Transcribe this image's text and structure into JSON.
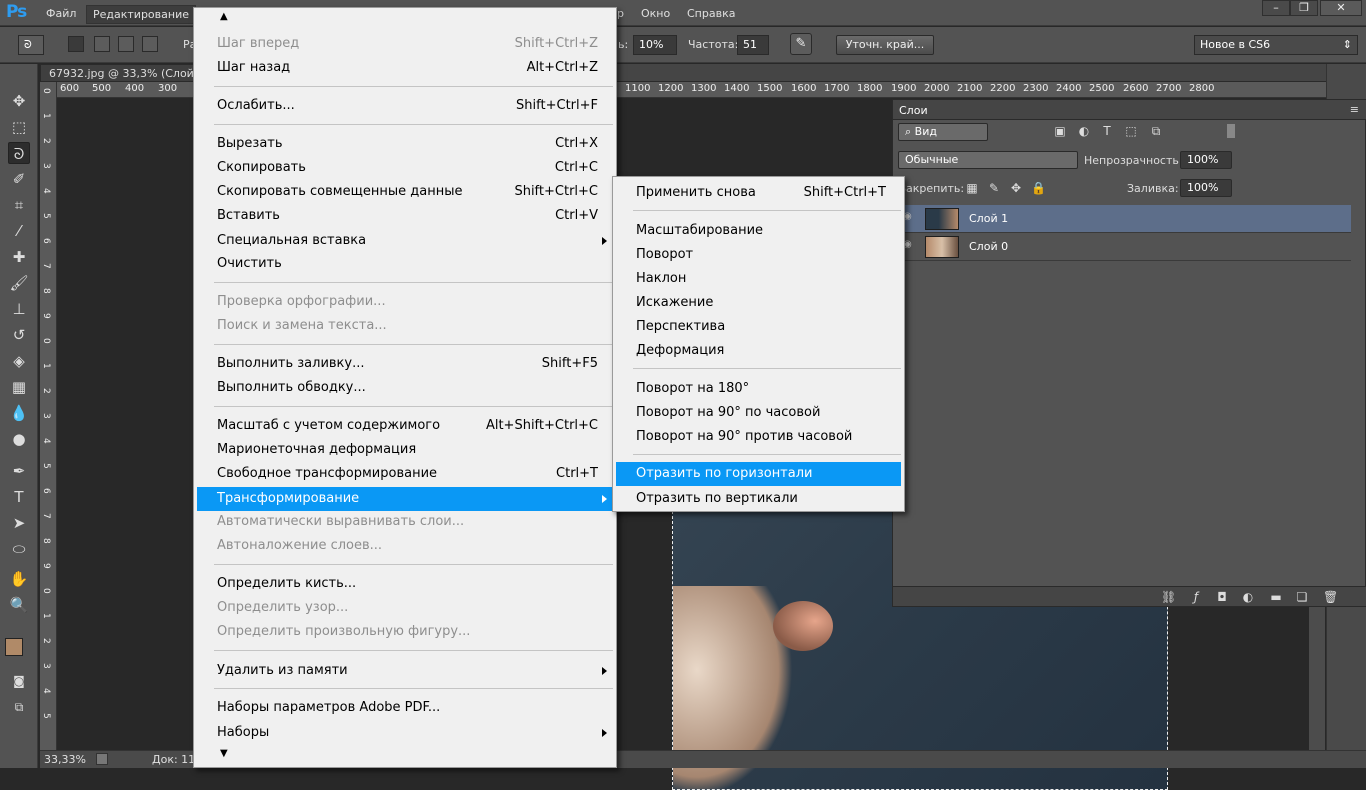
{
  "app": {
    "logo": "Ps"
  },
  "menubar": {
    "items": [
      "Файл",
      "Редактирование",
      "р",
      "Окно",
      "Справка"
    ],
    "window_buttons": [
      "–",
      "❐",
      "✕"
    ]
  },
  "options": {
    "partial_label": "Ра",
    "width_value": "10%",
    "width_label_partial": "ь:",
    "frequency_label": "Частота:",
    "frequency_value": "51",
    "refine_edge_button": "Уточн. край...",
    "workspace_select": "Новое в CS6"
  },
  "document": {
    "tab_title": "67932.jpg @ 33,3% (Слой",
    "zoom": "33,33%",
    "doc_info": "Док: 11"
  },
  "rulers": {
    "h_ticks": [
      "600",
      "500",
      "400",
      "300",
      "1100",
      "1200",
      "1300",
      "1400",
      "1500",
      "1600",
      "1700",
      "1800",
      "1900",
      "2000",
      "2100",
      "2200",
      "2300",
      "2400",
      "2500",
      "2600",
      "2700",
      "2800"
    ],
    "v_ticks": [
      "0",
      "1",
      "2",
      "3",
      "4",
      "5",
      "6",
      "7",
      "8",
      "9",
      "0",
      "1",
      "2",
      "3",
      "4",
      "5",
      "6",
      "7",
      "8",
      "9",
      "0",
      "1",
      "2",
      "3",
      "4",
      "5"
    ]
  },
  "layers_panel": {
    "title": "Слои",
    "filter_select": "Вид",
    "blend_mode": "Обычные",
    "opacity_label": "Непрозрачность:",
    "opacity_value": "100%",
    "lock_label": "Закрепить:",
    "fill_label": "Заливка:",
    "fill_value": "100%",
    "layers": [
      {
        "name": "Слой 1",
        "selected": true
      },
      {
        "name": "Слой 0",
        "selected": false
      }
    ]
  },
  "edit_menu": {
    "up_arrow": "▲",
    "down_arrow": "▼",
    "items": [
      {
        "label": "Шаг вперед",
        "shortcut": "Shift+Ctrl+Z",
        "disabled": true
      },
      {
        "label": "Шаг назад",
        "shortcut": "Alt+Ctrl+Z"
      },
      {
        "label": "Ослабить...",
        "shortcut": "Shift+Ctrl+F"
      },
      {
        "label": "Вырезать",
        "shortcut": "Ctrl+X"
      },
      {
        "label": "Скопировать",
        "shortcut": "Ctrl+C"
      },
      {
        "label": "Скопировать совмещенные данные",
        "shortcut": "Shift+Ctrl+C"
      },
      {
        "label": "Вставить",
        "shortcut": "Ctrl+V"
      },
      {
        "label": "Специальная вставка",
        "shortcut": "",
        "submenu": true
      },
      {
        "label": "Очистить",
        "shortcut": ""
      },
      {
        "label": "Проверка орфографии...",
        "shortcut": "",
        "disabled": true
      },
      {
        "label": "Поиск и замена текста...",
        "shortcut": "",
        "disabled": true
      },
      {
        "label": "Выполнить заливку...",
        "shortcut": "Shift+F5"
      },
      {
        "label": "Выполнить обводку...",
        "shortcut": ""
      },
      {
        "label": "Масштаб с учетом содержимого",
        "shortcut": "Alt+Shift+Ctrl+C"
      },
      {
        "label": "Марионеточная деформация",
        "shortcut": ""
      },
      {
        "label": "Свободное трансформирование",
        "shortcut": "Ctrl+T"
      },
      {
        "label": "Трансформирование",
        "shortcut": "",
        "submenu": true,
        "highlighted": true
      },
      {
        "label": "Автоматически выравнивать слои...",
        "shortcut": "",
        "disabled": true
      },
      {
        "label": "Автоналожение слоев...",
        "shortcut": "",
        "disabled": true
      },
      {
        "label": "Определить кисть...",
        "shortcut": ""
      },
      {
        "label": "Определить узор...",
        "shortcut": "",
        "disabled": true
      },
      {
        "label": "Определить произвольную фигуру...",
        "shortcut": "",
        "disabled": true
      },
      {
        "label": "Удалить из памяти",
        "shortcut": "",
        "submenu": true
      },
      {
        "label": "Наборы параметров Adobe PDF...",
        "shortcut": ""
      },
      {
        "label": "Наборы",
        "shortcut": "",
        "submenu": true
      }
    ]
  },
  "transform_submenu": {
    "items": [
      {
        "label": "Применить снова",
        "shortcut": "Shift+Ctrl+T"
      },
      {
        "label": "Масштабирование",
        "shortcut": ""
      },
      {
        "label": "Поворот",
        "shortcut": ""
      },
      {
        "label": "Наклон",
        "shortcut": ""
      },
      {
        "label": "Искажение",
        "shortcut": ""
      },
      {
        "label": "Перспектива",
        "shortcut": ""
      },
      {
        "label": "Деформация",
        "shortcut": ""
      },
      {
        "label": "Поворот на 180°",
        "shortcut": ""
      },
      {
        "label": "Поворот на 90° по часовой",
        "shortcut": ""
      },
      {
        "label": "Поворот на 90° против часовой",
        "shortcut": ""
      },
      {
        "label": "Отразить по горизонтали",
        "shortcut": "",
        "highlighted": true
      },
      {
        "label": "Отразить по вертикали",
        "shortcut": ""
      }
    ]
  },
  "colors": {
    "highlight": "#0a98f5",
    "menu_bg": "#f0f0f0",
    "ui_gray": "#535353",
    "foreground_swatch": "#b08a68",
    "background_swatch": "#ffffff"
  }
}
